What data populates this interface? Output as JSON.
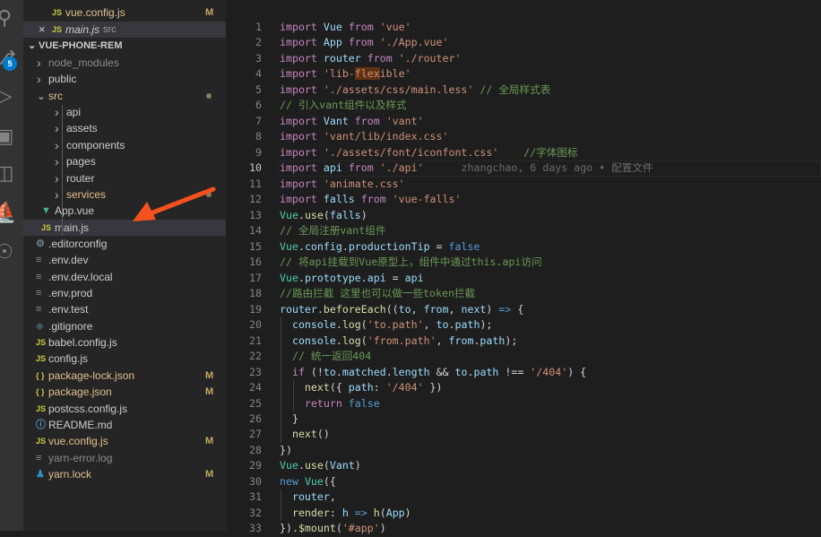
{
  "activity_bar": {
    "icons": [
      "search-icon",
      "source-control-icon",
      "run-debug-icon",
      "remote-explorer-icon",
      "extensions-icon",
      "docker-icon",
      "git-graph-icon"
    ],
    "source_control_badge": "5",
    "accent": "#007acc"
  },
  "open_editors": [
    {
      "name": "vue.config.js",
      "icon": "JS",
      "status": "M",
      "color": "#e2c08d"
    },
    {
      "name": "main.js",
      "icon": "JS",
      "path": "src",
      "close": "×",
      "color": "#cccccc"
    }
  ],
  "explorer": {
    "root": "VUE-PHONE-REM",
    "items": [
      {
        "name": "node_modules",
        "type": "folder",
        "depth": 1,
        "color": "#8c8c8c"
      },
      {
        "name": "public",
        "type": "folder",
        "depth": 1
      },
      {
        "name": "src",
        "type": "folder-open",
        "depth": 1,
        "color": "#e2c08d",
        "dot": true
      },
      {
        "name": "api",
        "type": "folder",
        "depth": 2
      },
      {
        "name": "assets",
        "type": "folder",
        "depth": 2
      },
      {
        "name": "components",
        "type": "folder",
        "depth": 2
      },
      {
        "name": "pages",
        "type": "folder",
        "depth": 2
      },
      {
        "name": "router",
        "type": "folder",
        "depth": 2
      },
      {
        "name": "services",
        "type": "folder",
        "depth": 2,
        "color": "#e2c08d",
        "dot": true
      },
      {
        "name": "App.vue",
        "type": "file",
        "icon": "vue",
        "depth": 2
      },
      {
        "name": "main.js",
        "type": "file",
        "icon": "JS",
        "depth": 2,
        "selected": true
      },
      {
        "name": ".editorconfig",
        "type": "file",
        "icon": "gear",
        "depth": 1
      },
      {
        "name": ".env.dev",
        "type": "file",
        "icon": "lines",
        "depth": 1
      },
      {
        "name": ".env.dev.local",
        "type": "file",
        "icon": "lines",
        "depth": 1
      },
      {
        "name": ".env.prod",
        "type": "file",
        "icon": "lines",
        "depth": 1
      },
      {
        "name": ".env.test",
        "type": "file",
        "icon": "lines",
        "depth": 1
      },
      {
        "name": ".gitignore",
        "type": "file",
        "icon": "diamond",
        "depth": 1
      },
      {
        "name": "babel.config.js",
        "type": "file",
        "icon": "JS",
        "depth": 1
      },
      {
        "name": "config.js",
        "type": "file",
        "icon": "JS",
        "depth": 1
      },
      {
        "name": "package-lock.json",
        "type": "file",
        "icon": "{}",
        "depth": 1,
        "color": "#e2c08d",
        "status": "M"
      },
      {
        "name": "package.json",
        "type": "file",
        "icon": "{}",
        "depth": 1,
        "color": "#e2c08d",
        "status": "M"
      },
      {
        "name": "postcss.config.js",
        "type": "file",
        "icon": "JS",
        "depth": 1
      },
      {
        "name": "README.md",
        "type": "file",
        "icon": "info",
        "depth": 1
      },
      {
        "name": "vue.config.js",
        "type": "file",
        "icon": "JS",
        "depth": 1,
        "color": "#e2c08d",
        "status": "M"
      },
      {
        "name": "yarn-error.log",
        "type": "file",
        "icon": "lines",
        "depth": 1,
        "color": "#8c8c8c"
      },
      {
        "name": "yarn.lock",
        "type": "file",
        "icon": "yarn",
        "depth": 1,
        "color": "#e2c08d",
        "status": "M"
      }
    ]
  },
  "annotation": {
    "arrow_color": "#f4511e"
  },
  "editor": {
    "current_line": 10,
    "blame": "zhangchao, 6 days ago • 配置文件",
    "lines": [
      [
        [
          "k",
          "import"
        ],
        [
          "p",
          " "
        ],
        [
          "v",
          "Vue"
        ],
        [
          "p",
          " "
        ],
        [
          "k",
          "from"
        ],
        [
          "p",
          " "
        ],
        [
          "s",
          "'vue'"
        ]
      ],
      [
        [
          "k",
          "import"
        ],
        [
          "p",
          " "
        ],
        [
          "v",
          "App"
        ],
        [
          "p",
          " "
        ],
        [
          "k",
          "from"
        ],
        [
          "p",
          " "
        ],
        [
          "s",
          "'./App.vue'"
        ]
      ],
      [
        [
          "k",
          "import"
        ],
        [
          "p",
          " "
        ],
        [
          "v",
          "router"
        ],
        [
          "p",
          " "
        ],
        [
          "k",
          "from"
        ],
        [
          "p",
          " "
        ],
        [
          "s",
          "'./router'"
        ]
      ],
      [
        [
          "k",
          "import"
        ],
        [
          "p",
          " "
        ],
        [
          "s",
          "'lib-"
        ],
        [
          "h",
          "flex"
        ],
        [
          "s",
          "ible'"
        ]
      ],
      [
        [
          "k",
          "import"
        ],
        [
          "p",
          " "
        ],
        [
          "s",
          "'./assets/css/main.less'"
        ],
        [
          "p",
          " "
        ],
        [
          "c",
          "// 全局样式表"
        ]
      ],
      [
        [
          "c",
          "// 引入vant组件以及样式"
        ]
      ],
      [
        [
          "k",
          "import"
        ],
        [
          "p",
          " "
        ],
        [
          "v",
          "Vant"
        ],
        [
          "p",
          " "
        ],
        [
          "k",
          "from"
        ],
        [
          "p",
          " "
        ],
        [
          "s",
          "'vant'"
        ]
      ],
      [
        [
          "k",
          "import"
        ],
        [
          "p",
          " "
        ],
        [
          "s",
          "'vant/lib/index.css'"
        ]
      ],
      [
        [
          "k",
          "import"
        ],
        [
          "p",
          " "
        ],
        [
          "s",
          "'./assets/font/iconfont.css'"
        ],
        [
          "p",
          "    "
        ],
        [
          "c",
          "//字体图标"
        ]
      ],
      [
        [
          "k",
          "import"
        ],
        [
          "p",
          " "
        ],
        [
          "v",
          "api"
        ],
        [
          "p",
          " "
        ],
        [
          "k",
          "from"
        ],
        [
          "p",
          " "
        ],
        [
          "s",
          "'./api'"
        ]
      ],
      [
        [
          "k",
          "import"
        ],
        [
          "p",
          " "
        ],
        [
          "s",
          "'animate.css'"
        ]
      ],
      [
        [
          "k",
          "import"
        ],
        [
          "p",
          " "
        ],
        [
          "v",
          "falls"
        ],
        [
          "p",
          " "
        ],
        [
          "k",
          "from"
        ],
        [
          "p",
          " "
        ],
        [
          "s",
          "'vue-falls'"
        ]
      ],
      [
        [
          "t",
          "Vue"
        ],
        [
          "p",
          "."
        ],
        [
          "f",
          "use"
        ],
        [
          "p",
          "("
        ],
        [
          "v",
          "falls"
        ],
        [
          "p",
          ")"
        ]
      ],
      [
        [
          "c",
          "// 全局注册vant组件"
        ]
      ],
      [
        [
          "t",
          "Vue"
        ],
        [
          "p",
          "."
        ],
        [
          "v",
          "config"
        ],
        [
          "p",
          "."
        ],
        [
          "v",
          "productionTip"
        ],
        [
          "p",
          " = "
        ],
        [
          "b",
          "false"
        ]
      ],
      [
        [
          "c",
          "// 将api挂载到Vue原型上，组件中通过this.api访问"
        ]
      ],
      [
        [
          "t",
          "Vue"
        ],
        [
          "p",
          "."
        ],
        [
          "v",
          "prototype"
        ],
        [
          "p",
          "."
        ],
        [
          "v",
          "api"
        ],
        [
          "p",
          " = "
        ],
        [
          "v",
          "api"
        ]
      ],
      [
        [
          "c",
          "//路由拦截 这里也可以做一些token拦截"
        ]
      ],
      [
        [
          "v",
          "router"
        ],
        [
          "p",
          "."
        ],
        [
          "f",
          "beforeEach"
        ],
        [
          "p",
          "(("
        ],
        [
          "v",
          "to"
        ],
        [
          "p",
          ", "
        ],
        [
          "v",
          "from"
        ],
        [
          "p",
          ", "
        ],
        [
          "v",
          "next"
        ],
        [
          "p",
          ") "
        ],
        [
          "b",
          "=>"
        ],
        [
          "p",
          " {"
        ]
      ],
      [
        [
          "p",
          "  "
        ],
        [
          "v",
          "console"
        ],
        [
          "p",
          "."
        ],
        [
          "f",
          "log"
        ],
        [
          "p",
          "("
        ],
        [
          "s",
          "'to.path'"
        ],
        [
          "p",
          ", "
        ],
        [
          "v",
          "to"
        ],
        [
          "p",
          "."
        ],
        [
          "v",
          "path"
        ],
        [
          "p",
          ");"
        ]
      ],
      [
        [
          "p",
          "  "
        ],
        [
          "v",
          "console"
        ],
        [
          "p",
          "."
        ],
        [
          "f",
          "log"
        ],
        [
          "p",
          "("
        ],
        [
          "s",
          "'from.path'"
        ],
        [
          "p",
          ", "
        ],
        [
          "v",
          "from"
        ],
        [
          "p",
          "."
        ],
        [
          "v",
          "path"
        ],
        [
          "p",
          ");"
        ]
      ],
      [
        [
          "p",
          "  "
        ],
        [
          "c",
          "// 统一返回404"
        ]
      ],
      [
        [
          "p",
          "  "
        ],
        [
          "k",
          "if"
        ],
        [
          "p",
          " (!"
        ],
        [
          "v",
          "to"
        ],
        [
          "p",
          "."
        ],
        [
          "v",
          "matched"
        ],
        [
          "p",
          "."
        ],
        [
          "v",
          "length"
        ],
        [
          "p",
          " && "
        ],
        [
          "v",
          "to"
        ],
        [
          "p",
          "."
        ],
        [
          "v",
          "path"
        ],
        [
          "p",
          " !== "
        ],
        [
          "s",
          "'/404'"
        ],
        [
          "p",
          ") {"
        ]
      ],
      [
        [
          "p",
          "    "
        ],
        [
          "f",
          "next"
        ],
        [
          "p",
          "({ "
        ],
        [
          "v",
          "path"
        ],
        [
          "p",
          ": "
        ],
        [
          "s",
          "'/404'"
        ],
        [
          "p",
          " })"
        ]
      ],
      [
        [
          "p",
          "    "
        ],
        [
          "k",
          "return"
        ],
        [
          "p",
          " "
        ],
        [
          "b",
          "false"
        ]
      ],
      [
        [
          "p",
          "  }"
        ]
      ],
      [
        [
          "p",
          "  "
        ],
        [
          "f",
          "next"
        ],
        [
          "p",
          "()"
        ]
      ],
      [
        [
          "p",
          "})"
        ]
      ],
      [
        [
          "t",
          "Vue"
        ],
        [
          "p",
          "."
        ],
        [
          "f",
          "use"
        ],
        [
          "p",
          "("
        ],
        [
          "v",
          "Vant"
        ],
        [
          "p",
          ")"
        ]
      ],
      [
        [
          "b",
          "new"
        ],
        [
          "p",
          " "
        ],
        [
          "t",
          "Vue"
        ],
        [
          "p",
          "({"
        ]
      ],
      [
        [
          "p",
          "  "
        ],
        [
          "v",
          "router"
        ],
        [
          "p",
          ","
        ]
      ],
      [
        [
          "p",
          "  "
        ],
        [
          "f",
          "render"
        ],
        [
          "p",
          ": "
        ],
        [
          "v",
          "h"
        ],
        [
          "p",
          " "
        ],
        [
          "b",
          "=>"
        ],
        [
          "p",
          " "
        ],
        [
          "f",
          "h"
        ],
        [
          "p",
          "("
        ],
        [
          "v",
          "App"
        ],
        [
          "p",
          ")"
        ]
      ],
      [
        [
          "p",
          "})."
        ],
        [
          "f",
          "$mount"
        ],
        [
          "p",
          "("
        ],
        [
          "s",
          "'#app'"
        ],
        [
          "p",
          ")"
        ]
      ]
    ]
  }
}
